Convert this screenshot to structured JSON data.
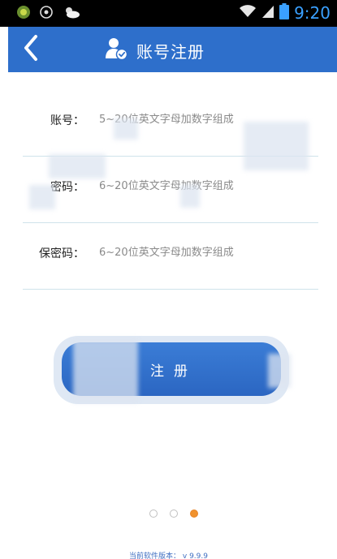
{
  "status_bar": {
    "time": "9:20",
    "icons": [
      "app-icon",
      "camera-icon",
      "weather-icon",
      "wifi-icon",
      "signal-icon",
      "battery-icon"
    ]
  },
  "header": {
    "title": "账号注册",
    "back_icon": "chevron-left-icon",
    "title_icon": "user-verified-icon",
    "background": "#2e6fcb"
  },
  "form": {
    "fields": [
      {
        "label": "账号：",
        "placeholder": "5~20位英文字母加数字组成"
      },
      {
        "label": "密码：",
        "placeholder": "6~20位英文字母加数字组成"
      },
      {
        "label": "保密码：",
        "placeholder": "6~20位英文字母加数字组成"
      }
    ]
  },
  "actions": {
    "register_label": "注册",
    "accent": "#2e6fcb"
  },
  "pagination": {
    "total": 3,
    "active_index": 2,
    "active_color": "#f0922e"
  },
  "footer": {
    "version_text": "当前软件版本：  v 9.9.9"
  }
}
